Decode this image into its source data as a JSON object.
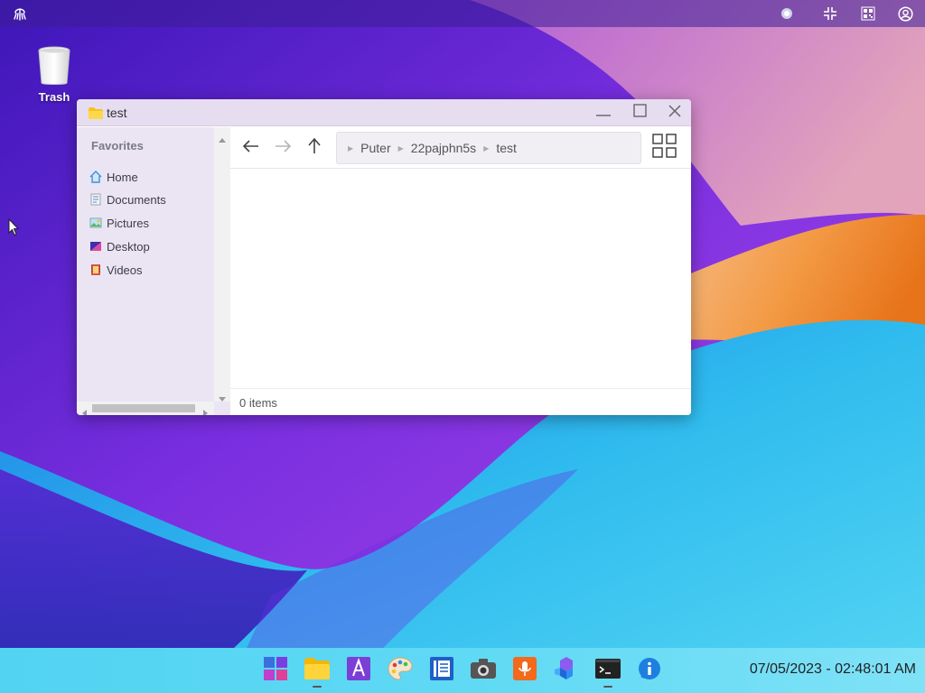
{
  "desktop": {
    "icons": [
      {
        "label": "Trash",
        "icon": "trash-icon"
      }
    ]
  },
  "topbar": {
    "icons": [
      "puter-logo-icon",
      "record-icon",
      "exit-fullscreen-icon",
      "qr-code-icon",
      "user-account-icon"
    ]
  },
  "window": {
    "title": "test",
    "title_icon": "folder-icon",
    "controls": [
      "minimize-icon",
      "maximize-icon",
      "close-icon"
    ],
    "sidebar": {
      "heading": "Favorites",
      "items": [
        {
          "label": "Home",
          "icon": "home-icon"
        },
        {
          "label": "Documents",
          "icon": "documents-icon"
        },
        {
          "label": "Pictures",
          "icon": "pictures-icon"
        },
        {
          "label": "Desktop",
          "icon": "desktop-icon"
        },
        {
          "label": "Videos",
          "icon": "videos-icon"
        }
      ]
    },
    "navigation": {
      "buttons": [
        "back-arrow-icon",
        "forward-arrow-icon",
        "up-arrow-icon"
      ],
      "breadcrumbs": [
        "Puter",
        "22pajphn5s",
        "test"
      ],
      "view_toggle": "grid-view-icon"
    },
    "status": "0 items"
  },
  "taskbar": {
    "apps": [
      {
        "name": "start-menu-icon",
        "running": false
      },
      {
        "name": "file-explorer-icon",
        "running": true
      },
      {
        "name": "text-editor-icon",
        "running": false
      },
      {
        "name": "paint-icon",
        "running": false
      },
      {
        "name": "notes-icon",
        "running": false
      },
      {
        "name": "camera-icon",
        "running": false
      },
      {
        "name": "recorder-icon",
        "running": false
      },
      {
        "name": "blocks-game-icon",
        "running": false
      },
      {
        "name": "terminal-icon",
        "running": true
      },
      {
        "name": "about-icon",
        "running": false
      }
    ],
    "clock": "07/05/2023 - 02:48:01 AM"
  },
  "colors": {
    "wallpaper_purple": "#6a1fd8",
    "wallpaper_blue": "#2fb6ef",
    "wallpaper_orange": "#f28a2b",
    "window_titlebar": "#e6ddf1",
    "sidebar_bg": "#ebe5f3",
    "taskbar": "#5fd9f4"
  }
}
